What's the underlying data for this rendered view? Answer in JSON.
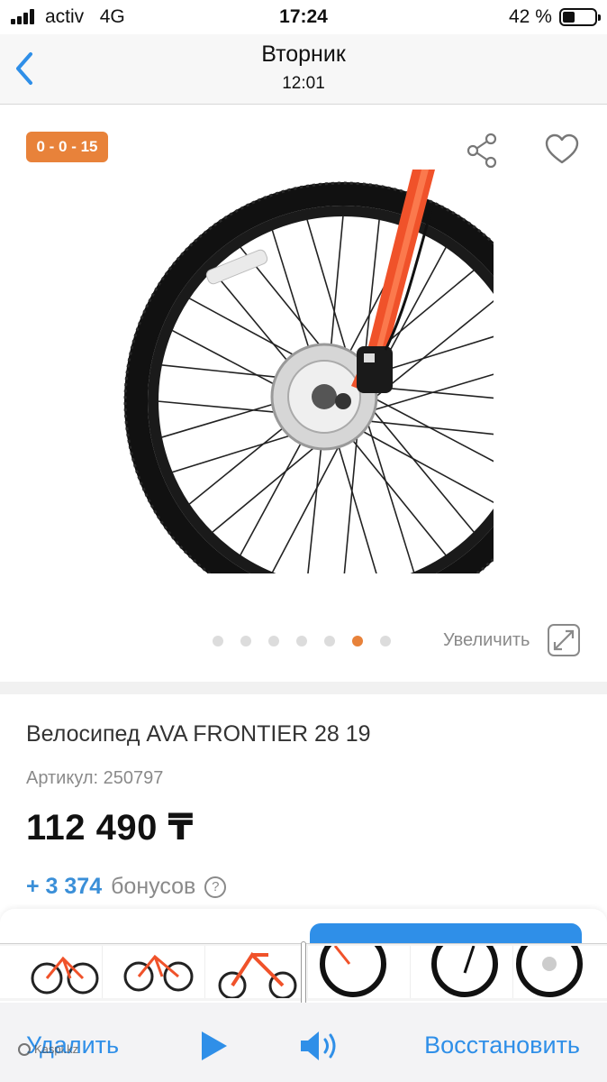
{
  "status_bar": {
    "carrier": "activ",
    "network": "4G",
    "time": "17:24",
    "battery_percent": "42 %"
  },
  "header": {
    "title": "Вторник",
    "subtitle": "12:01"
  },
  "product": {
    "badge": "0 - 0 - 15",
    "zoom_label": "Увеличить",
    "gallery_total": 7,
    "gallery_active_index": 6,
    "title": "Велосипед AVA FRONTIER 28 19",
    "sku": "Артикул: 250797",
    "price": "112 490 ₸",
    "bonus_amount": "+ 3 374",
    "bonus_label": "бонусов",
    "help_glyph": "?"
  },
  "toolbar": {
    "delete_label": "Удалить",
    "restore_label": "Восстановить",
    "watermark": "Kaspi.kz"
  },
  "colors": {
    "accent": "#e8823a",
    "link": "#2f8fe8",
    "frame": "#f0522a"
  }
}
